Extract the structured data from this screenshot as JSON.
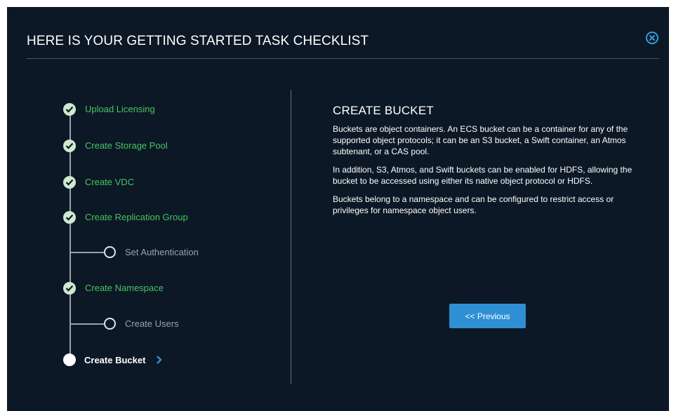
{
  "dialog": {
    "title": "HERE IS YOUR GETTING STARTED TASK CHECKLIST",
    "close_icon": "close-circle-icon"
  },
  "steps": [
    {
      "label": "Upload Licensing",
      "status": "complete"
    },
    {
      "label": "Create Storage Pool",
      "status": "complete"
    },
    {
      "label": "Create VDC",
      "status": "complete"
    },
    {
      "label": "Create Replication Group",
      "status": "complete"
    },
    {
      "label": "Set Authentication",
      "status": "optional"
    },
    {
      "label": "Create Namespace",
      "status": "complete"
    },
    {
      "label": "Create Users",
      "status": "optional"
    },
    {
      "label": "Create Bucket",
      "status": "current"
    }
  ],
  "content": {
    "heading": "CREATE BUCKET",
    "paragraphs": [
      "Buckets are object containers. An ECS bucket can be a container for any of the supported object protocols; it can be an S3 bucket, a Swift container, an Atmos subtenant, or a CAS pool.",
      "In addition, S3, Atmos, and Swift buckets can be enabled for HDFS, allowing the bucket to be accessed using either its native object protocol or HDFS.",
      "Buckets belong to a namespace and can be configured to restrict access or privileges for namespace object users."
    ]
  },
  "buttons": {
    "previous_label": "<< Previous"
  },
  "colors": {
    "background": "#0c1825",
    "complete": "#47c461",
    "accent": "#2f8fd4",
    "muted": "#9aa3ab"
  }
}
